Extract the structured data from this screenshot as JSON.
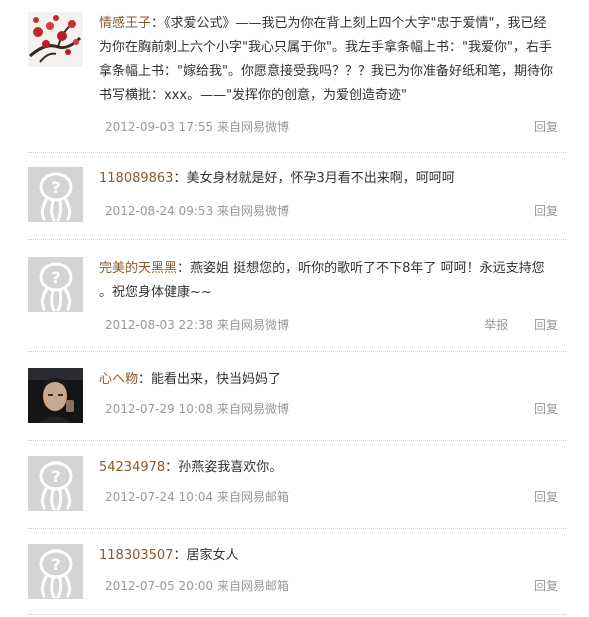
{
  "comments": [
    {
      "user": "情感王子",
      "text": "《求爱公式》——我已为你在背上刻上四个大字\"忠于爱情\"，我已经为你在胸前刺上六个小字\"我心只属于你\"。我左手拿条幅上书：\"我爱你\"，右手拿条幅上书：\"嫁给我\"。你愿意接受我吗？？？我已为你准备好纸和笔，期待你书写横批：xxx。——\"发挥你的创意，为爱创造奇迹\"",
      "time": "2012-09-03 17:55",
      "source": "来自网易微博",
      "actions": [
        "回复"
      ],
      "avatar": "plum-blossom-avatar"
    },
    {
      "user": "118089863",
      "text": "美女身材就是好，怀孕3月看不出来啊，呵呵呵",
      "time": "2012-08-24 09:53",
      "source": "来自网易微博",
      "actions": [
        "回复"
      ],
      "avatar": "default-avatar"
    },
    {
      "user": "完美的天黑黑",
      "text": "燕姿姐 挺想您的，听你的歌听了不下8年了 呵呵！永远支持您 。祝您身体健康~~",
      "time": "2012-08-03 22:38",
      "source": "来自网易微博",
      "actions": [
        "举报",
        "回复"
      ],
      "avatar": "default-avatar"
    },
    {
      "user": "心ヘ粅",
      "text": "能看出来，快当妈妈了",
      "time": "2012-07-29 10:08",
      "source": "来自网易微博",
      "actions": [
        "回复"
      ],
      "avatar": "photo-avatar"
    },
    {
      "user": "54234978",
      "text": "孙燕姿我喜欢你。",
      "time": "2012-07-24 10:04",
      "source": "来自网易邮箱",
      "actions": [
        "回复"
      ],
      "avatar": "default-avatar"
    },
    {
      "user": "118303507",
      "text": "居家女人",
      "time": "2012-07-05 20:00",
      "source": "来自网易邮箱",
      "actions": [
        "回复"
      ],
      "avatar": "default-avatar"
    }
  ],
  "colors": {
    "username": "#8a5a2b",
    "meta": "#999999",
    "placeholder": "#cccccc"
  }
}
